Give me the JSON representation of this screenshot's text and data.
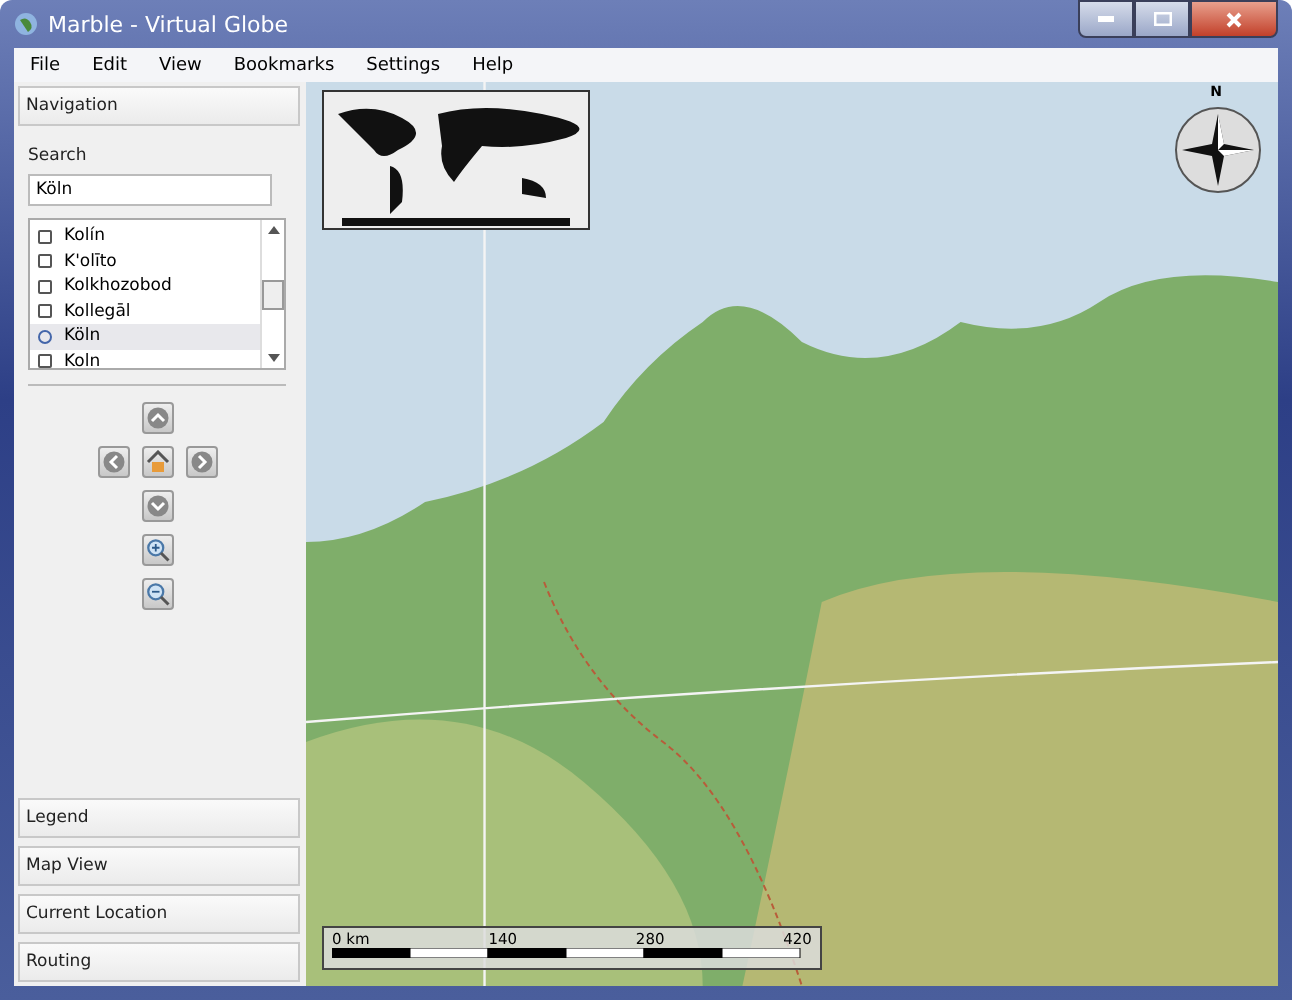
{
  "window": {
    "title": "Marble - Virtual Globe"
  },
  "menu": [
    "File",
    "Edit",
    "View",
    "Bookmarks",
    "Settings",
    "Help"
  ],
  "navigation": {
    "title": "Navigation",
    "search_label": "Search",
    "search_value": "Köln",
    "results": [
      {
        "label": "Kolín",
        "selected": false
      },
      {
        "label": "K'olīto",
        "selected": false
      },
      {
        "label": "Kolkhozobod",
        "selected": false
      },
      {
        "label": "Kollegāl",
        "selected": false
      },
      {
        "label": "Köln",
        "selected": true
      },
      {
        "label": "Koln",
        "selected": false
      }
    ]
  },
  "sections": [
    "Legend",
    "Map View",
    "Current Location",
    "Routing"
  ],
  "map": {
    "compass_label": "N",
    "scale": [
      "0 km",
      "140",
      "280",
      "420"
    ]
  }
}
